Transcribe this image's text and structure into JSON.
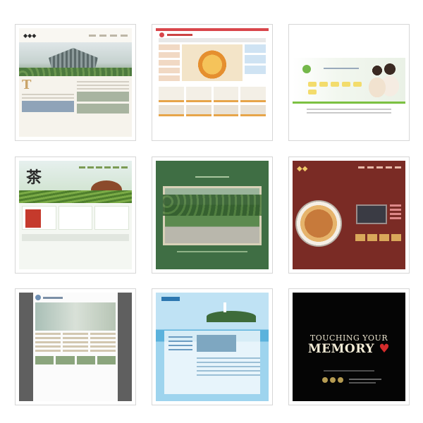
{
  "gallery": {
    "tiles": [
      {
        "id": 1,
        "label": "tile-1"
      },
      {
        "id": 2,
        "label": "tile-2"
      },
      {
        "id": 3,
        "label": "tile-3"
      },
      {
        "id": 4,
        "label": "tile-4"
      },
      {
        "id": 5,
        "label": "tile-5"
      },
      {
        "id": 6,
        "label": "tile-6"
      },
      {
        "id": 7,
        "label": "tile-7"
      },
      {
        "id": 8,
        "label": "tile-8"
      },
      {
        "id": 9,
        "label": "tile-9"
      }
    ]
  },
  "tile9": {
    "line1": "TOUCHING YOUR",
    "line2": "MEMORY"
  },
  "tile1": {
    "big_letter": "T"
  },
  "colors": {
    "border": "#d6d6d6",
    "tile4_green": "#6f9c48",
    "tile5_green": "#3f6e44",
    "tile6_red": "#7a2b25",
    "tile8_blue": "#5bb2dc",
    "tile9_black": "#050505"
  }
}
